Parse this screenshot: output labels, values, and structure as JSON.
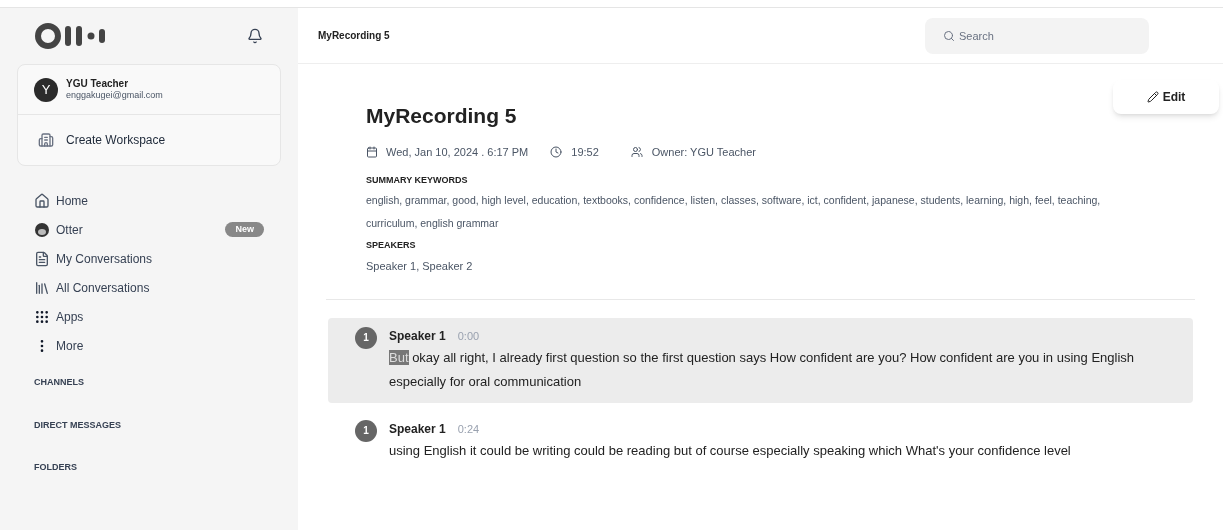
{
  "sidebar": {
    "account": {
      "avatar_letter": "Y",
      "name": "YGU Teacher",
      "email": "enggakugei@gmail.com"
    },
    "create_workspace": "Create Workspace",
    "nav": [
      {
        "label": "Home"
      },
      {
        "label": "Otter",
        "badge": "New"
      },
      {
        "label": "My Conversations"
      },
      {
        "label": "All Conversations"
      },
      {
        "label": "Apps"
      },
      {
        "label": "More"
      }
    ],
    "sections": [
      "CHANNELS",
      "DIRECT MESSAGES",
      "FOLDERS"
    ]
  },
  "header": {
    "title": "MyRecording 5",
    "search": {
      "placeholder": "Search"
    }
  },
  "recording": {
    "edit_button": "Edit",
    "title": "MyRecording 5",
    "date": "Wed, Jan 10, 2024 . 6:17 PM",
    "duration": "19:52",
    "owner": "Owner: YGU Teacher",
    "keywords_heading": "SUMMARY KEYWORDS",
    "keywords": "english, grammar, good, high level, education, textbooks, confidence, listen, classes, software, ict, confident, japanese, students, learning, high, feel, teaching, curriculum, english grammar",
    "speakers_heading": "SPEAKERS",
    "speakers": "Speaker 1, Speaker 2"
  },
  "transcript": [
    {
      "avatar": "1",
      "speaker": "Speaker 1",
      "time": "0:00",
      "selected": true,
      "highlighted": "But",
      "text": " okay all right, I already first question so the first question says How confident are you? How confident are you in using English especially for oral communication"
    },
    {
      "avatar": "1",
      "speaker": "Speaker 1",
      "time": "0:24",
      "selected": false,
      "text": "using English it could be writing could be reading but of course especially speaking which What's your confidence level"
    }
  ]
}
